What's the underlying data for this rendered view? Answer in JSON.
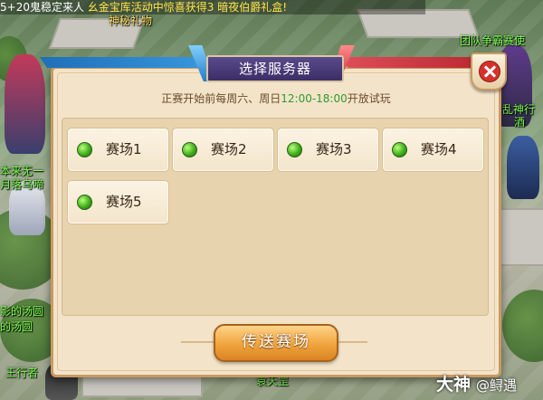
{
  "scene": {
    "ticker": "5+20鬼稳定来人",
    "ticker_event": "幺金宝库活动中惊喜获得3",
    "ticker_event2": "暗夜伯爵礼盒!",
    "name_top_left": "神秘礼物",
    "name_right_1": "团队争霸赛使",
    "name_right_2": "乱神行",
    "name_right_3": "酒",
    "name_left_1": "本来无一",
    "name_left_2": "月落乌啼",
    "name_left_3": "影的汤圆",
    "name_left_4": "的汤圆",
    "name_bottom_left": "王行者",
    "name_bottom_center": "袁天罡"
  },
  "dialog": {
    "title": "选择服务器",
    "notice_prefix": "正赛开始前每周六、周日",
    "notice_time": "12:00-18:00",
    "notice_suffix": "开放试玩",
    "servers": [
      {
        "label": "赛场1",
        "status_color": "#3fae1c"
      },
      {
        "label": "赛场2",
        "status_color": "#3fae1c"
      },
      {
        "label": "赛场3",
        "status_color": "#3fae1c"
      },
      {
        "label": "赛场4",
        "status_color": "#3fae1c"
      },
      {
        "label": "赛场5",
        "status_color": "#3fae1c"
      }
    ],
    "action_label": "传送赛场",
    "close_icon": "close-x-icon"
  },
  "watermark": {
    "brand": "大神",
    "handle": "@鲟遇"
  },
  "colors": {
    "title_plate": "#3b2e66",
    "panel_bg": "#f3e4c9",
    "accent_green": "#2f9a2f",
    "button_orange": "#f0a43c"
  }
}
